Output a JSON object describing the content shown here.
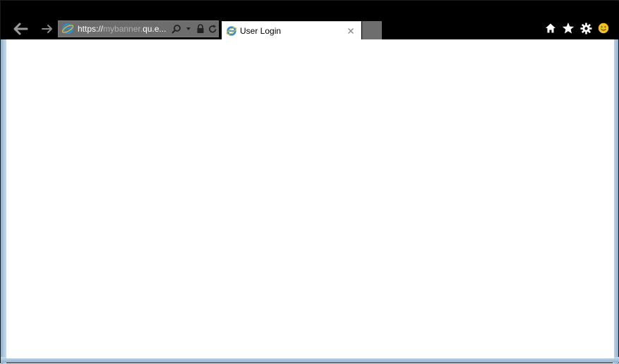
{
  "browser": {
    "address": {
      "url_scheme": "https://",
      "url_host_dim": "mybanner.",
      "url_host_bright": "qu.e..."
    },
    "tab": {
      "title": "User Login"
    },
    "icons": {
      "back": "back-arrow-icon",
      "forward": "forward-arrow-icon",
      "search": "search-icon",
      "dropdown": "chevron-down-icon",
      "lock": "lock-icon",
      "refresh": "refresh-icon",
      "close": "close-icon",
      "home": "home-icon",
      "favorites": "star-icon",
      "tools": "gear-icon",
      "feedback": "smiley-icon"
    },
    "colors": {
      "chrome": "#000000",
      "address_bg": "#6d6d6d",
      "tab_bg": "#ffffff",
      "frame": "#a9c4dd",
      "smiley": "#f2c21b"
    }
  }
}
